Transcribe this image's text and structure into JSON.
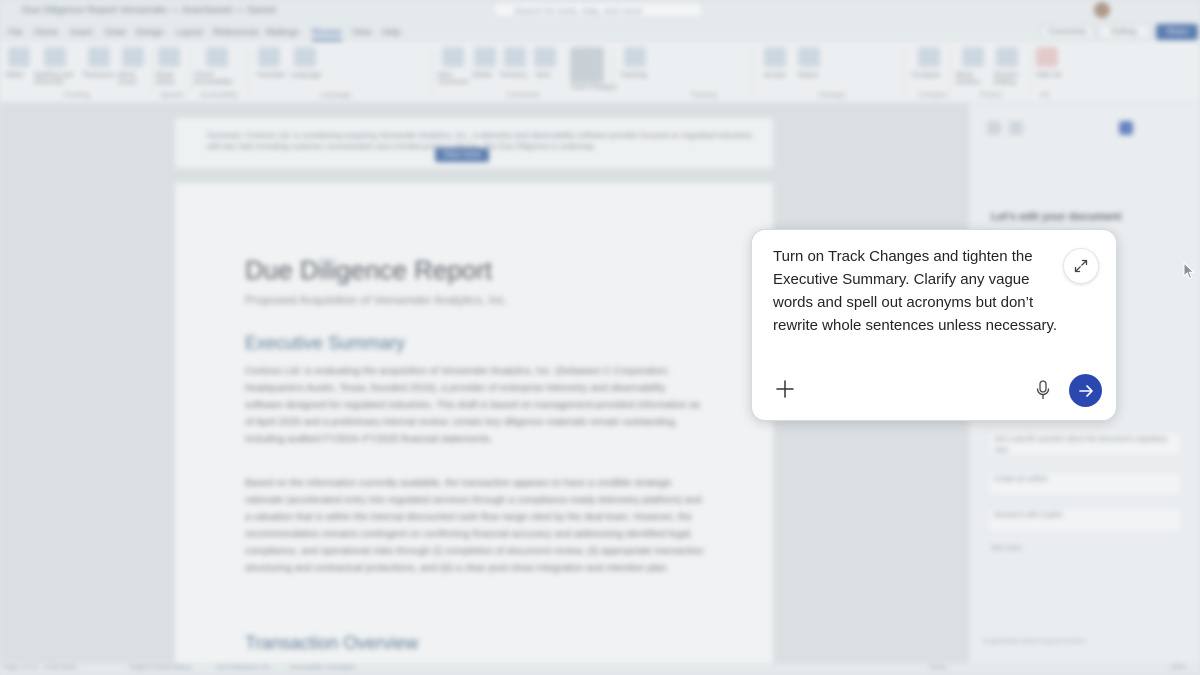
{
  "titlebar": {
    "title": "Due Diligence Report Vensender — AutoSaved — Saved",
    "search_placeholder": "Search for tools, help, and more"
  },
  "tabs": [
    {
      "label": "File"
    },
    {
      "label": "Home"
    },
    {
      "label": "Insert"
    },
    {
      "label": "Draw"
    },
    {
      "label": "Design"
    },
    {
      "label": "Layout"
    },
    {
      "label": "References"
    },
    {
      "label": "Mailings"
    },
    {
      "label": "Review"
    },
    {
      "label": "View"
    },
    {
      "label": "Help"
    }
  ],
  "tab_buttons": {
    "comments": "Comments",
    "editing": "Editing",
    "share": "Share"
  },
  "ribbon": {
    "buttons": [
      {
        "label": "Editor"
      },
      {
        "label": "Spelling and Grammar"
      },
      {
        "label": "Thesaurus"
      },
      {
        "label": "Word Count"
      },
      {
        "label": "Read Aloud"
      },
      {
        "label": "Check Accessibility"
      },
      {
        "label": "Translate"
      },
      {
        "label": "Language"
      },
      {
        "label": "New Comment"
      },
      {
        "label": "Delete"
      },
      {
        "label": "Previous"
      },
      {
        "label": "Next"
      },
      {
        "label": "Track Changes"
      },
      {
        "label": "Tracking"
      },
      {
        "label": "Accept"
      },
      {
        "label": "Reject"
      },
      {
        "label": "Compare"
      },
      {
        "label": "Block Authors"
      },
      {
        "label": "Restrict Editing"
      },
      {
        "label": "Hide Ink"
      }
    ],
    "groups": [
      "Proofing",
      "Speech",
      "Accessibility",
      "Language",
      "Comments",
      "Tracking",
      "Changes",
      "Compare",
      "Protect",
      "Ink"
    ]
  },
  "notice": {
    "text": "Summary: Contoso Ltd. is considering acquiring Vensender Analytics, Inc., a telemetry and observability software provider focused on regulated industries, with key risks including customer concentration and a limited product offering. The Due Diligence is underway.",
    "view_more": "View more"
  },
  "document": {
    "title": "Due Diligence Report",
    "subtitle": "Proposed Acquisition of Vensender Analytics, Inc.",
    "section1": "Executive Summary",
    "para1": "Contoso Ltd. is evaluating the acquisition of Vensender Analytics, Inc. (Delaware C-Corporation; headquarters Austin, Texas; founded 2016), a provider of enterprise telemetry and observability software designed for regulated industries. This draft is based on management-provided information as of April 2026 and a preliminary internal review; certain key diligence materials remain outstanding, including audited FY2024–FY2025 financial statements.",
    "para2": "Based on the information currently available, the transaction appears to have a credible strategic rationale (accelerated entry into regulated services through a compliance-ready telemetry platform) and a valuation that is within the internal discounted cash flow range cited by the deal team. However, the recommendation remains contingent on confirming financial accuracy and addressing identified legal, compliance, and operational risks through (i) completion of document review, (ii) appropriate transaction structuring and contractual protections, and (iii) a clear post-close integration and retention plan.",
    "section2": "Transaction Overview"
  },
  "copilot_pane": {
    "heading": "Let's edit your document",
    "cards": [
      "Ask a specific question about the document's regulatory risks",
      "Create an outline",
      "Research with Copilot"
    ],
    "see_more": "See more",
    "footer": "AI-generated content may be incorrect"
  },
  "statusbar": {
    "page": "Page 1 of 12",
    "words": "4,318 words",
    "language": "English (United States)",
    "predictions": "Text Predictions: On",
    "accessibility": "Accessibility: Investigate",
    "focus": "Focus",
    "zoom": "100%"
  },
  "prompt": {
    "text": "Turn on Track Changes and tighten the Executive Summary. Clarify any vague words and spell out acronyms but don’t rewrite whole sentences unless necessary.",
    "send_color": "#2b47b0"
  },
  "icons": [
    "expand-icon",
    "plus-icon",
    "microphone-icon",
    "send-arrow-icon",
    "pointer-cursor-icon"
  ]
}
